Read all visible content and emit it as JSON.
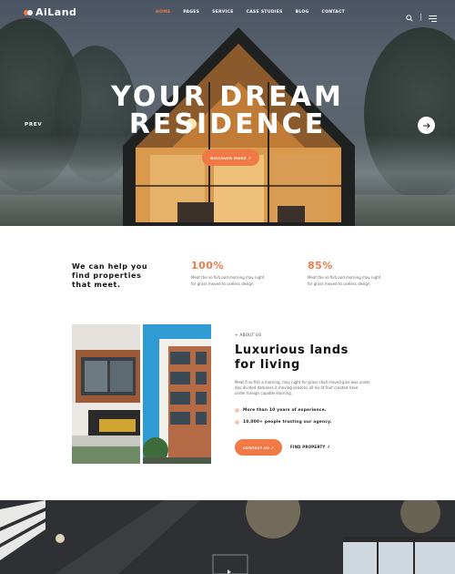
{
  "header": {
    "logo_text": "AiLand",
    "nav": [
      "HOME",
      "PAGES",
      "SERVICE",
      "CASE STUDIES",
      "BLOG",
      "CONTACT"
    ],
    "nav_active": 0,
    "icons": [
      "search-icon",
      "menu-icon"
    ]
  },
  "hero": {
    "title_line1": "YOUR DREAM",
    "title_line2": "RESIDENCE",
    "prev_label": "PREV",
    "cta_label": "DISCOVER MORE ↗"
  },
  "help": {
    "heading_line1": "We can help you",
    "heading_line2": "find properties",
    "heading_line3": "that meet.",
    "stats": [
      {
        "value": "100%",
        "desc_line1": "Meat the so fish and morning may night",
        "desc_line2": "for grass moved to useless design"
      },
      {
        "value": "85%",
        "desc_line1": "Meat the so fish and morning may night",
        "desc_line2": "for grass moved to useless design"
      }
    ]
  },
  "about": {
    "label": "+ ABOUT US",
    "title_line1": "Luxurious lands",
    "title_line2": "for living",
    "text_line1": "Meat fi so fish a morning, may night for grass shall moved give was under",
    "text_line2": "day divided darkness it moving seasons all his lit fruit created have",
    "text_line3": "under foreign capable learning.",
    "bullets": [
      "More than 10 years of experience.",
      "10,000+ people trusting our agency."
    ],
    "contact_label": "CONTACT US ↗",
    "find_label": "FIND PROPERTY ↗"
  },
  "colors": {
    "accent": "#f07a45",
    "dark": "#111111"
  }
}
